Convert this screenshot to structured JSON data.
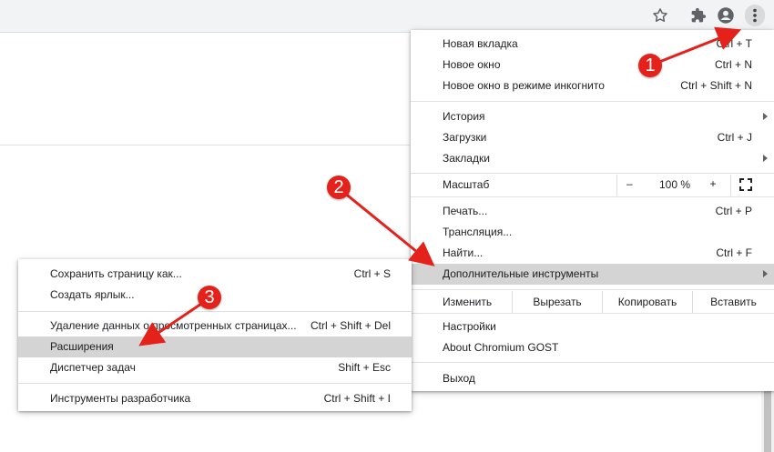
{
  "toolbar": {
    "icons": [
      "star-icon",
      "puzzle-icon",
      "account-icon",
      "more-vert-icon"
    ]
  },
  "main_menu": {
    "items_top": [
      {
        "label": "Новая вкладка",
        "shortcut": "Ctrl + T"
      },
      {
        "label": "Новое окно",
        "shortcut": "Ctrl + N"
      },
      {
        "label": "Новое окно в режиме инкогнито",
        "shortcut": "Ctrl + Shift + N"
      }
    ],
    "items_mid": [
      {
        "label": "История",
        "shortcut": ""
      },
      {
        "label": "Загрузки",
        "shortcut": "Ctrl + J"
      },
      {
        "label": "Закладки",
        "shortcut": ""
      }
    ],
    "zoom": {
      "label": "Масштаб",
      "minus": "–",
      "value": "100 %",
      "plus": "+"
    },
    "items_tools": [
      {
        "label": "Печать...",
        "shortcut": "Ctrl + P"
      },
      {
        "label": "Трансляция...",
        "shortcut": ""
      },
      {
        "label": "Найти...",
        "shortcut": "Ctrl + F"
      },
      {
        "label": "Дополнительные инструменты",
        "shortcut": ""
      }
    ],
    "edit": {
      "label": "Изменить",
      "cut": "Вырезать",
      "copy": "Копировать",
      "paste": "Вставить"
    },
    "items_settings": [
      {
        "label": "Настройки"
      },
      {
        "label": "About Chromium GOST"
      }
    ],
    "exit": {
      "label": "Выход"
    }
  },
  "sub_menu": {
    "items": [
      {
        "label": "Сохранить страницу как...",
        "shortcut": "Ctrl + S"
      },
      {
        "label": "Создать ярлык...",
        "shortcut": ""
      },
      {
        "label": "Удаление данных о просмотренных страницах...",
        "shortcut": "Ctrl + Shift + Del"
      },
      {
        "label": "Расширения",
        "shortcut": ""
      },
      {
        "label": "Диспетчер задач",
        "shortcut": "Shift + Esc"
      },
      {
        "label": "Инструменты разработчика",
        "shortcut": "Ctrl + Shift + I"
      }
    ]
  },
  "annotations": {
    "color": "#e5211b",
    "badges": [
      "1",
      "2",
      "3"
    ]
  },
  "colors": {
    "highlight": "#d4d4d4",
    "toolbar_bg": "#f1f3f4",
    "icon": "#5f6368"
  }
}
